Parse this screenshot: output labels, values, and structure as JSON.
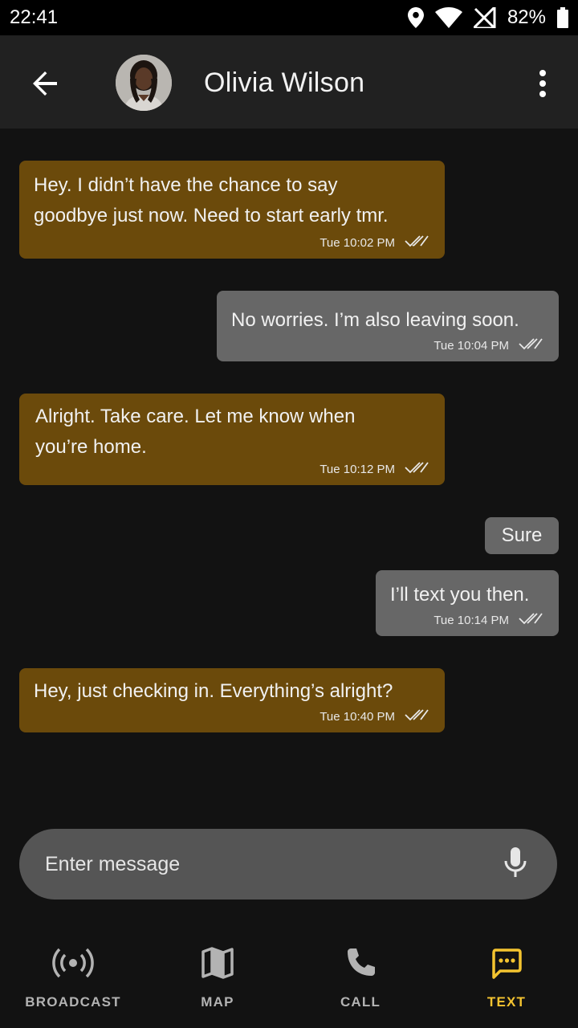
{
  "status_bar": {
    "time": "22:41",
    "battery": "82%",
    "icons": [
      "location-icon",
      "wifi-icon",
      "no-signal-icon",
      "battery-icon"
    ]
  },
  "header": {
    "contact_name": "Olivia Wilson",
    "back_icon": "arrow-left-icon",
    "menu_icon": "more-vertical-icon"
  },
  "messages": [
    {
      "direction": "incoming",
      "text": "Hey. I didn’t have the chance to say\ngoodbye just now. Need to start early tmr.",
      "time": "Tue 10:02 PM",
      "receipt": "double-check-icon"
    },
    {
      "direction": "outgoing",
      "text": "No worries. I’m also leaving soon.",
      "time": "Tue 10:04 PM",
      "receipt": "double-check-icon"
    },
    {
      "direction": "incoming",
      "text": "Alright. Take care. Let me know when\nyou’re home.",
      "time": "Tue 10:12 PM",
      "receipt": "double-check-icon"
    },
    {
      "direction": "outgoing",
      "text": "Sure",
      "time": "",
      "receipt": ""
    },
    {
      "direction": "outgoing",
      "text": "I’ll text you then.",
      "time": "Tue 10:14 PM",
      "receipt": "double-check-icon"
    },
    {
      "direction": "incoming",
      "text": "Hey, just checking in. Everything’s alright?",
      "time": "Tue 10:40 PM",
      "receipt": "double-check-icon"
    }
  ],
  "composer": {
    "placeholder": "Enter message",
    "value": "",
    "mic_icon": "microphone-icon"
  },
  "bottom_nav": {
    "items": [
      {
        "label": "BROADCAST",
        "icon": "broadcast-icon",
        "active": false
      },
      {
        "label": "MAP",
        "icon": "map-icon",
        "active": false
      },
      {
        "label": "CALL",
        "icon": "phone-icon",
        "active": false
      },
      {
        "label": "TEXT",
        "icon": "chat-bubble-icon",
        "active": true
      }
    ]
  },
  "colors": {
    "incoming_bubble": "#6b4a0b",
    "outgoing_bubble": "#676767",
    "active_nav": "#f4c430",
    "background": "#121212",
    "header": "#212121"
  }
}
